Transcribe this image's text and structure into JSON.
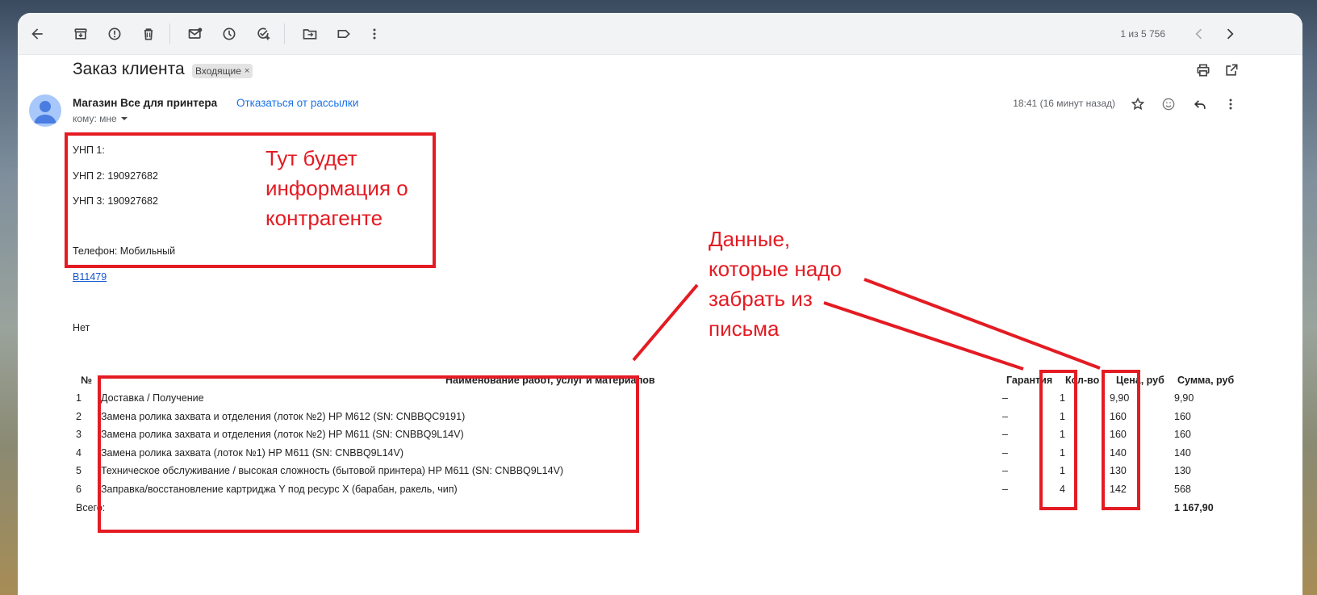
{
  "toolbar": {
    "icons": [
      "back-arrow-icon",
      "archive-icon",
      "report-spam-icon",
      "delete-icon",
      "mark-unread-icon",
      "snooze-icon",
      "add-task-icon",
      "move-to-icon",
      "label-icon",
      "more-vert-icon"
    ],
    "pager": "1 из 5 756"
  },
  "email": {
    "subject": "Заказ клиента",
    "label_chip": "Входящие",
    "label_chip_close": "×",
    "sender": "Магазин Все для принтера",
    "unsubscribe": "Отказаться от рассылки",
    "recipient": "кому: мне",
    "time": "18:41 (16 минут назад)",
    "body": {
      "unp1": "УНП 1:",
      "unp2": "УНП 2: 190927682",
      "unp3": "УНП 3: 190927682",
      "phone": "Телефон: Мобильный",
      "order_link": "B11479",
      "no": "Нет"
    },
    "table": {
      "headers": {
        "num": "№",
        "name": "Наименование работ, услуг и материалов",
        "warranty": "Гарантия",
        "qty": "Кол-во",
        "price": "Цена, руб",
        "sum": "Сумма, руб"
      },
      "rows": [
        {
          "num": "1",
          "name": "Доставка / Получение",
          "warranty": "–",
          "qty": "1",
          "price": "9,90",
          "sum": "9,90"
        },
        {
          "num": "2",
          "name": "Замена ролика захвата и отделения (лоток №2) HP M612 (SN: CNBBQC9191)",
          "warranty": "–",
          "qty": "1",
          "price": "160",
          "sum": "160"
        },
        {
          "num": "3",
          "name": "Замена ролика захвата и отделения (лоток №2) HP M611 (SN: CNBBQ9L14V)",
          "warranty": "–",
          "qty": "1",
          "price": "160",
          "sum": "160"
        },
        {
          "num": "4",
          "name": "Замена ролика захвата (лоток №1) HP M611 (SN: CNBBQ9L14V)",
          "warranty": "–",
          "qty": "1",
          "price": "140",
          "sum": "140"
        },
        {
          "num": "5",
          "name": "Техническое обслуживание / высокая сложность (бытовой принтера) HP M611 (SN: CNBBQ9L14V)",
          "warranty": "–",
          "qty": "1",
          "price": "130",
          "sum": "130"
        },
        {
          "num": "6",
          "name": "Заправка/восстановление картриджа Y под ресурс X (барабан, ракель, чип)",
          "warranty": "–",
          "qty": "4",
          "price": "142",
          "sum": "568"
        }
      ],
      "total_label": "Всего:",
      "total_value": "1 167,90"
    }
  },
  "annotations": {
    "contractor_note": [
      "Тут будет",
      "информация о",
      "контрагенте"
    ],
    "data_note": [
      "Данные,",
      "которые надо",
      "забрать из",
      "письма"
    ],
    "color": "#e41b23"
  }
}
